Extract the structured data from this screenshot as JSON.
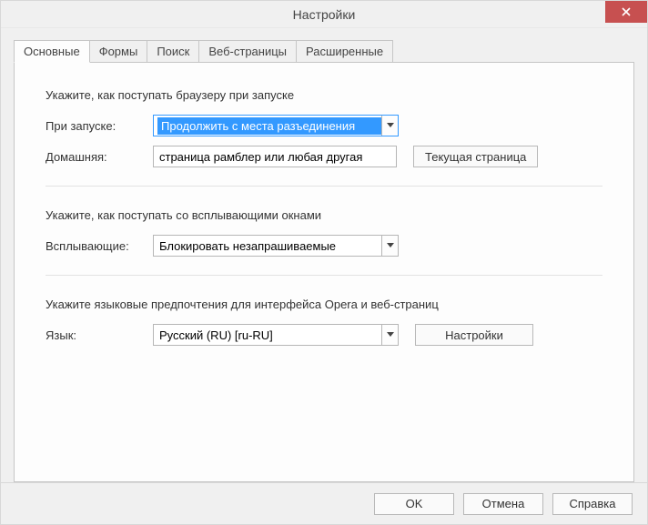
{
  "window": {
    "title": "Настройки"
  },
  "tabs": [
    {
      "label": "Основные"
    },
    {
      "label": "Формы"
    },
    {
      "label": "Поиск"
    },
    {
      "label": "Веб-страницы"
    },
    {
      "label": "Расширенные"
    }
  ],
  "sections": {
    "startup": {
      "heading": "Укажите, как поступать браузеру при запуске",
      "on_startup_label": "При запуске:",
      "on_startup_value": "Продолжить с места разъединения",
      "home_label": "Домашняя:",
      "home_value": "страница рамблер или любая другая",
      "current_page_btn": "Текущая страница"
    },
    "popups": {
      "heading": "Укажите, как поступать со всплывающими окнами",
      "popups_label": "Всплывающие:",
      "popups_value": "Блокировать незапрашиваемые"
    },
    "language": {
      "heading": "Укажите языковые предпочтения для интерфейса Opera и веб-страниц",
      "language_label": "Язык:",
      "language_value": "Русский (RU) [ru-RU]",
      "settings_btn": "Настройки"
    }
  },
  "footer": {
    "ok": "OK",
    "cancel": "Отмена",
    "help": "Справка"
  }
}
